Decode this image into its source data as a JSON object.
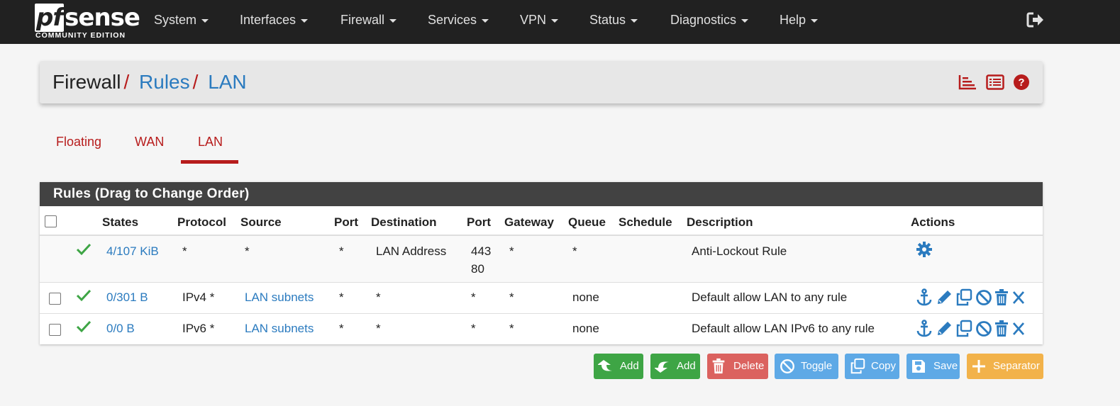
{
  "brand": {
    "logo_text_pf": "pf",
    "logo_text_sense": "sense",
    "edition": "COMMUNITY EDITION"
  },
  "nav": {
    "items": [
      "System",
      "Interfaces",
      "Firewall",
      "Services",
      "VPN",
      "Status",
      "Diagnostics",
      "Help"
    ]
  },
  "breadcrumb": {
    "part1": "Firewall",
    "sep": "/",
    "part2": "Rules",
    "part3": "LAN"
  },
  "tabs": [
    "Floating",
    "WAN",
    "LAN"
  ],
  "active_tab": "LAN",
  "table": {
    "title": "Rules (Drag to Change Order)",
    "headers": {
      "states": "States",
      "protocol": "Protocol",
      "source": "Source",
      "port": "Port",
      "destination": "Destination",
      "dport": "Port",
      "gateway": "Gateway",
      "queue": "Queue",
      "schedule": "Schedule",
      "description": "Description",
      "actions": "Actions"
    },
    "rows": [
      {
        "states": "4/107 KiB",
        "protocol": "*",
        "source": "*",
        "port": "*",
        "destination": "LAN Address",
        "dport1": "443",
        "dport2": "80",
        "gateway": "*",
        "queue": "*",
        "schedule": "",
        "description": "Anti-Lockout Rule"
      },
      {
        "states": "0/301 B",
        "protocol": "IPv4 *",
        "source": "LAN subnets",
        "port": "*",
        "destination": "*",
        "dport1": "*",
        "gateway": "*",
        "queue": "none",
        "schedule": "",
        "description": "Default allow LAN to any rule"
      },
      {
        "states": "0/0 B",
        "protocol": "IPv6 *",
        "source": "LAN subnets",
        "port": "*",
        "destination": "*",
        "dport1": "*",
        "gateway": "*",
        "queue": "none",
        "schedule": "",
        "description": "Default allow LAN IPv6 to any rule"
      }
    ]
  },
  "buttons": {
    "add_top": "Add",
    "add_bottom": "Add",
    "delete": "Delete",
    "toggle": "Toggle",
    "copy": "Copy",
    "save": "Save",
    "separator": "Separator"
  },
  "colors": {
    "accent_red": "#b71c1c",
    "link_blue": "#2b7bbf",
    "success_green": "#3ea545",
    "nav_bg": "#212121"
  }
}
